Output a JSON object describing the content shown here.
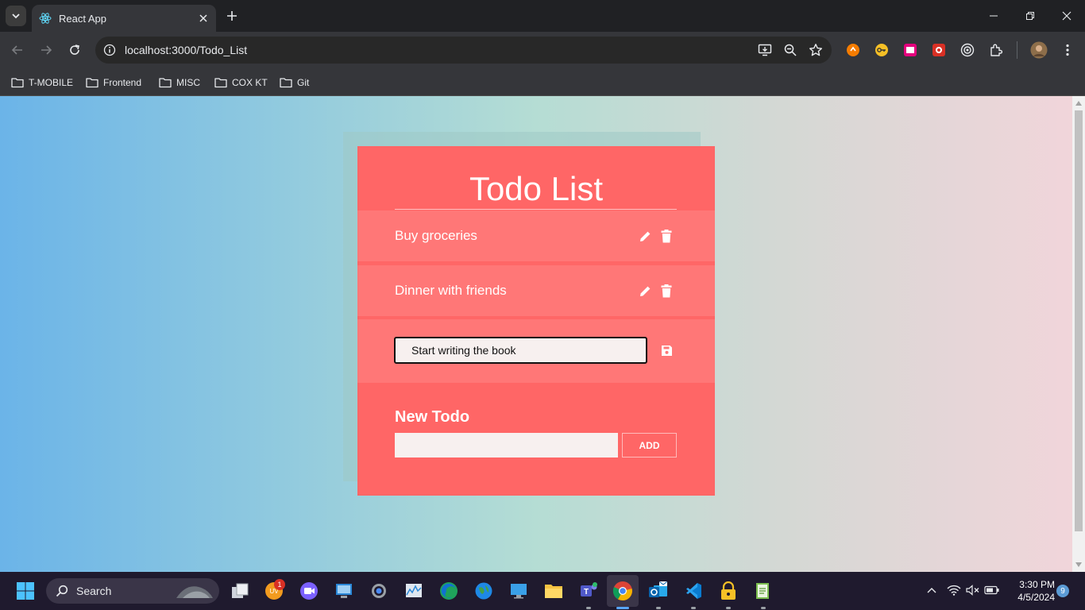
{
  "browser": {
    "tab_title": "React App",
    "url": "localhost:3000/Todo_List",
    "bookmarks": [
      "T-MOBILE",
      "Frontend",
      "MISC",
      "COX KT",
      "Git"
    ]
  },
  "app": {
    "title": "Todo List",
    "todos": [
      {
        "text": "Buy groceries",
        "editing": false
      },
      {
        "text": "Dinner with friends",
        "editing": false
      },
      {
        "text": "Start writing the book",
        "editing": true
      }
    ],
    "new_todo_label": "New Todo",
    "new_todo_value": "",
    "add_button": "ADD"
  },
  "taskbar": {
    "search_label": "Search",
    "mail_badge": "1",
    "time": "3:30 PM",
    "date": "4/5/2024",
    "notification_count": "9"
  },
  "colors": {
    "card": "#ff6666",
    "row": "#ff7777",
    "bg_left": "#6bb4e8",
    "bg_right": "#f1d5da"
  }
}
